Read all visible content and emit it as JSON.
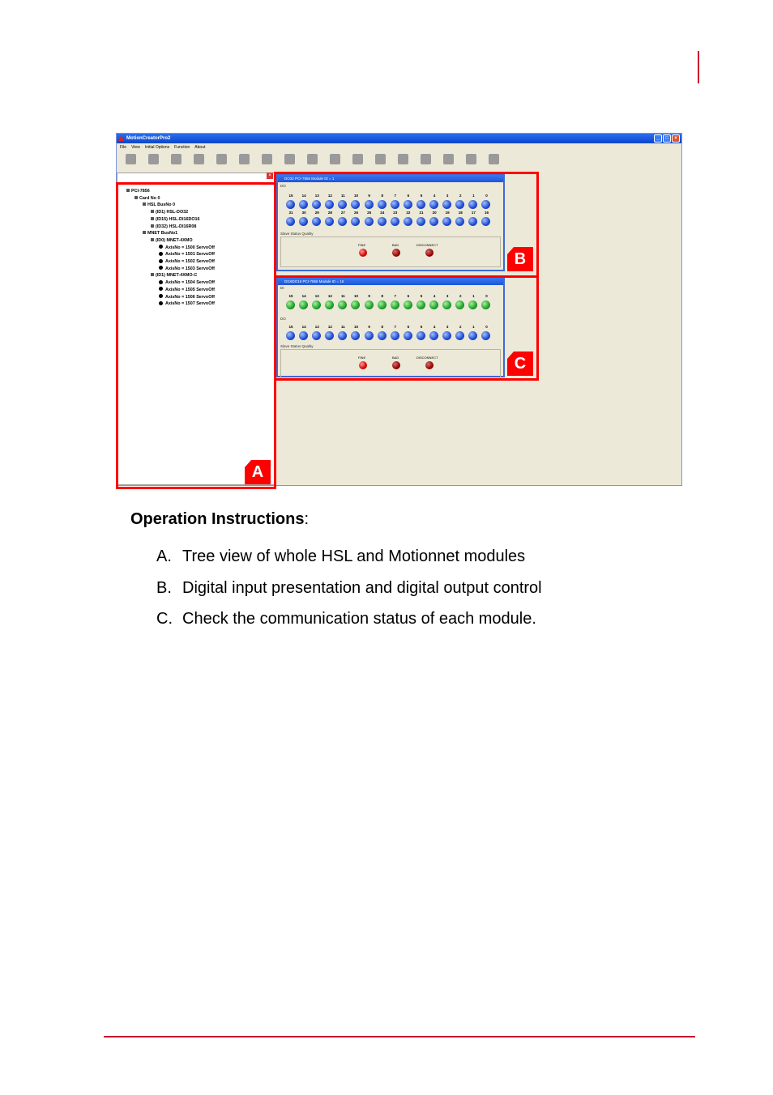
{
  "app": {
    "title": "MotionCreatorPro2",
    "menu": [
      "File",
      "View",
      "Initial Options",
      "Function",
      "About"
    ],
    "toolbar_icons": [
      "connect-icon",
      "disconnect-icon",
      "hsl-icon",
      "servo-icon",
      "single-icon",
      "motion-icon",
      "interpolation-icon",
      "gantry-icon",
      "sampling-icon",
      "io-icon",
      "chart-icon",
      "stop-icon",
      "field-connect-icon",
      "field-disconnect-icon",
      "field-monitor-icon",
      "home-icon",
      "exit-icon"
    ]
  },
  "tree": {
    "items": [
      {
        "text": "PCI-7856",
        "level": 0
      },
      {
        "text": "Card No 0",
        "level": 1
      },
      {
        "text": "HSL BusNo 0",
        "level": 2
      },
      {
        "text": "(ID1) HSL-DO32",
        "level": 3
      },
      {
        "text": "(ID15) HSL-DI16DO16",
        "level": 3
      },
      {
        "text": "(ID32) HSL-DI16R08",
        "level": 3
      },
      {
        "text": "MNET BusNo1",
        "level": 2
      },
      {
        "text": "(ID0) MNET-4XMO",
        "level": 3
      },
      {
        "text": "AxisNo = 1500 ServoOff",
        "level": 4
      },
      {
        "text": "AxisNo = 1501 ServoOff",
        "level": 4
      },
      {
        "text": "AxisNo = 1502 ServoOff",
        "level": 4
      },
      {
        "text": "AxisNo = 1503 ServoOff",
        "level": 4
      },
      {
        "text": "(ID1) MNET-4XMO-C",
        "level": 3
      },
      {
        "text": "AxisNo = 1504 ServoOff",
        "level": 4
      },
      {
        "text": "AxisNo = 1505 ServoOff",
        "level": 4
      },
      {
        "text": "AxisNo = 1506 ServoOff",
        "level": 4
      },
      {
        "text": "AxisNo = 1507 ServoOff",
        "level": 4
      }
    ]
  },
  "module_b": {
    "title": "DO32 PCI-7856 Module ID = 1",
    "section": "DO",
    "row1": [
      "15",
      "14",
      "13",
      "12",
      "11",
      "10",
      "9",
      "8",
      "7",
      "6",
      "5",
      "4",
      "3",
      "2",
      "1",
      "0"
    ],
    "row2": [
      "31",
      "30",
      "29",
      "28",
      "27",
      "26",
      "25",
      "24",
      "23",
      "22",
      "21",
      "20",
      "19",
      "18",
      "17",
      "16"
    ],
    "status_label": "Slave Status Quality",
    "status": [
      "FINE",
      "BAD",
      "DISCONNECT"
    ]
  },
  "module_c": {
    "title": "DI16DO16 PCI-7856 Module ID = 15",
    "section_di": "DI",
    "section_do": "DO",
    "row": [
      "15",
      "14",
      "13",
      "12",
      "11",
      "10",
      "9",
      "8",
      "7",
      "6",
      "5",
      "4",
      "3",
      "2",
      "1",
      "0"
    ],
    "status_label": "Slave Status Quality",
    "status": [
      "FINE",
      "BAD",
      "DISCONNECT"
    ]
  },
  "callouts": {
    "a": "A",
    "b": "B",
    "c": "C"
  },
  "instructions": {
    "heading": "Operation Instructions",
    "colon": ":",
    "items": [
      {
        "marker": "A.",
        "text": "Tree view of whole HSL and Motionnet modules"
      },
      {
        "marker": "B.",
        "text": "Digital input presentation and digital output control"
      },
      {
        "marker": "C.",
        "text": "Check the communication status of each module."
      }
    ]
  }
}
